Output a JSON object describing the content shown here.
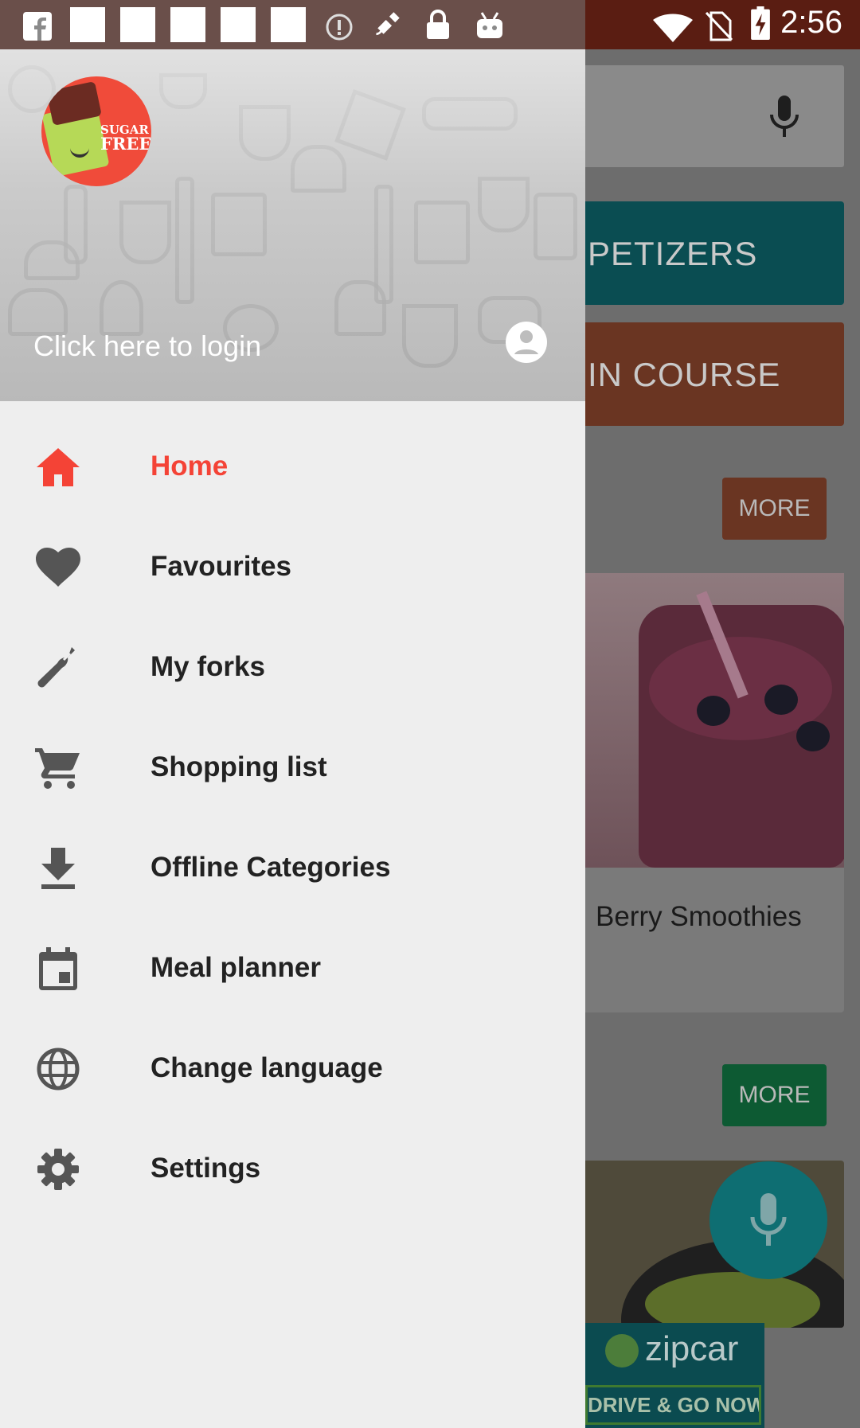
{
  "status_bar": {
    "time": "2:56"
  },
  "background_app": {
    "categories": [
      {
        "label": "PETIZERS",
        "color": "#00838f"
      },
      {
        "label": "IN COURSE",
        "color": "#c24d1d"
      }
    ],
    "more_buttons": [
      {
        "label": "MORE",
        "color": "#c24d1d"
      },
      {
        "label": "MORE",
        "color": "#00a854"
      }
    ],
    "recipe_title": "Berry Smoothies",
    "ad": {
      "brand": "zipcar",
      "tagline": "DRIVE & GO NOW"
    }
  },
  "drawer": {
    "logo_text": {
      "line1": "SUGAR",
      "line2": "FREE"
    },
    "login_text": "Click here to login",
    "accent_color": "#f44336",
    "items": [
      {
        "label": "Home",
        "icon": "home-icon",
        "active": true
      },
      {
        "label": "Favourites",
        "icon": "heart-icon",
        "active": false
      },
      {
        "label": "My forks",
        "icon": "fork-icon",
        "active": false
      },
      {
        "label": "Shopping list",
        "icon": "cart-icon",
        "active": false
      },
      {
        "label": "Offline Categories",
        "icon": "download-icon",
        "active": false
      },
      {
        "label": "Meal planner",
        "icon": "calendar-icon",
        "active": false
      },
      {
        "label": "Change language",
        "icon": "globe-icon",
        "active": false
      },
      {
        "label": "Settings",
        "icon": "gear-icon",
        "active": false
      }
    ]
  }
}
